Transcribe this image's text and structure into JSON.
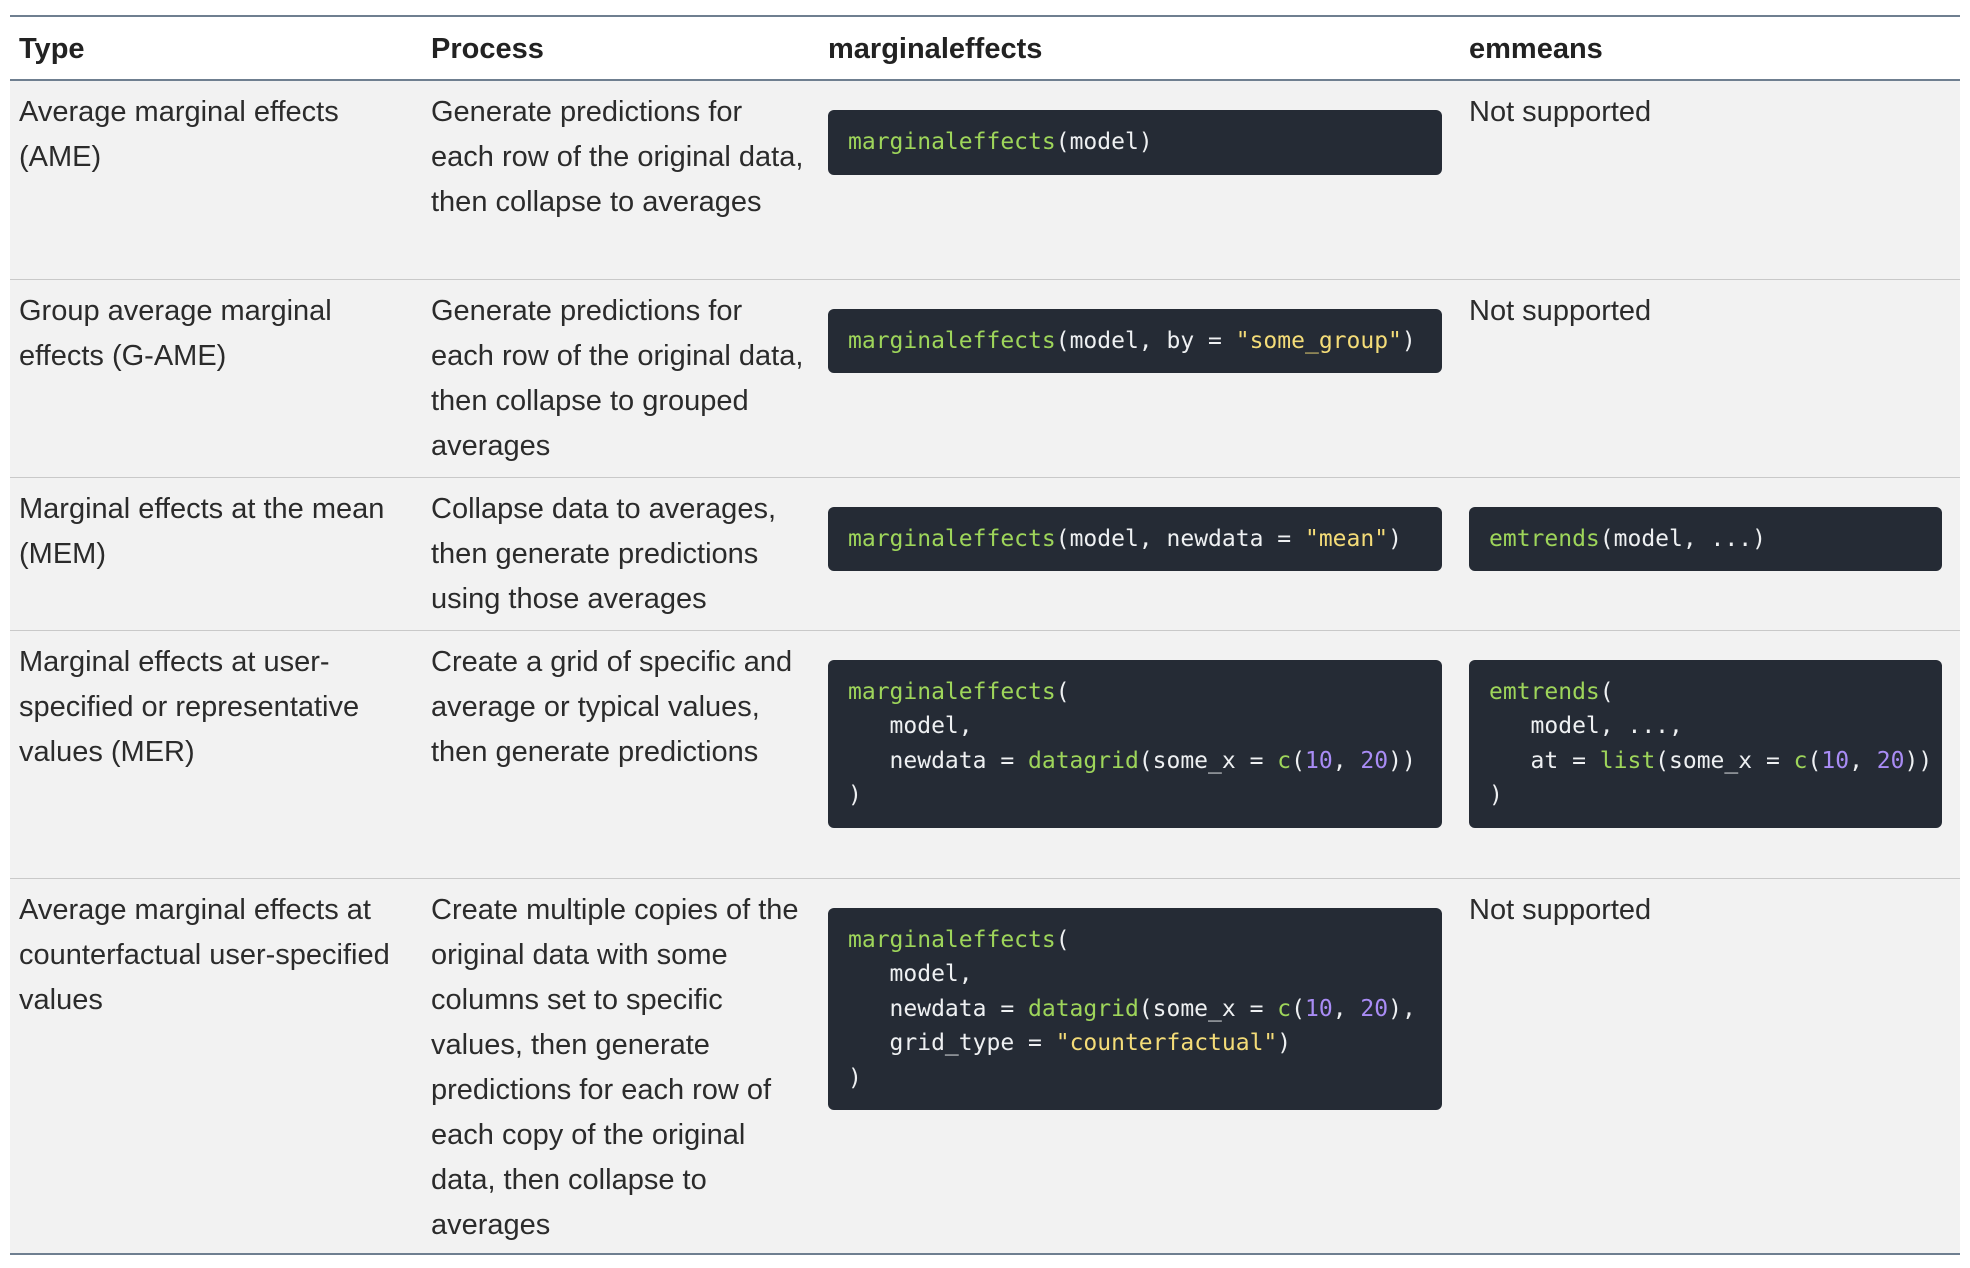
{
  "table": {
    "headers": [
      "Type",
      "Process",
      "marginaleffects",
      "emmeans"
    ],
    "rows": [
      {
        "type": "Average marginal effects (AME)",
        "process": "Generate predictions for each row of the original data, then collapse to averages",
        "marginaleffects_code": "marginaleffects(model)",
        "emmeans": "Not supported"
      },
      {
        "type": "Group average marginal effects (G-AME)",
        "process": "Generate predictions for each row of the original data, then collapse to grouped averages",
        "marginaleffects_code": "marginaleffects(model, by = \"some_group\")",
        "emmeans": "Not supported"
      },
      {
        "type": "Marginal effects at the mean (MEM)",
        "process": "Collapse data to averages, then generate predictions using those averages",
        "marginaleffects_code": "marginaleffects(model, newdata = \"mean\")",
        "emmeans_code": "emtrends(model, ...)"
      },
      {
        "type": "Marginal effects at user-specified or representative values (MER)",
        "process": "Create a grid of specific and average or typical values, then generate predictions",
        "marginaleffects_code": "marginaleffects(\n   model,\n   newdata = datagrid(some_x = c(10, 20))\n)",
        "emmeans_code": "emtrends(\n   model, ...,\n   at = list(some_x = c(10, 20))\n)"
      },
      {
        "type": "Average marginal effects at counterfactual user-specified values",
        "process": "Create multiple copies of the original data with some columns set to specific values, then generate predictions for each row of each copy of the original data, then collapse to averages",
        "marginaleffects_code": "marginaleffects(\n   model,\n   newdata = datagrid(some_x = c(10, 20),\n   grid_type = \"counterfactual\")\n)",
        "emmeans": "Not supported"
      }
    ]
  },
  "colors": {
    "code_bg": "#252b35",
    "function": "#9ed55a",
    "string": "#f4dc78",
    "number": "#a98cf5",
    "row_bg": "#f2f2f2",
    "rule": "#6f7f90"
  }
}
